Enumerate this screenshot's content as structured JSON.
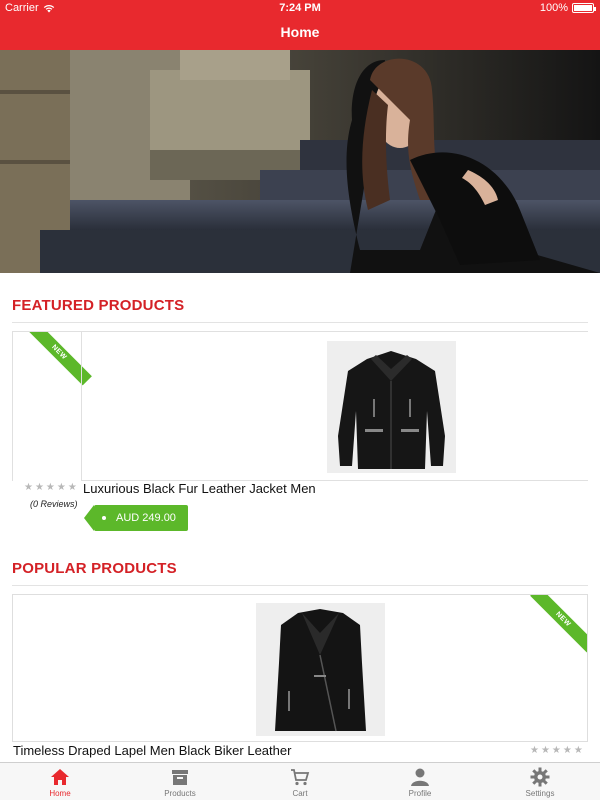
{
  "status_bar": {
    "carrier": "Carrier",
    "time": "7:24 PM",
    "battery": "100%"
  },
  "header": {
    "title": "Home"
  },
  "featured": {
    "title": "FEATURED PRODUCTS",
    "product": {
      "badge": "NEW",
      "name": "Luxurious Black Fur Leather Jacket Men",
      "rating_stars": "★★★★★",
      "reviews": "(0 Reviews)",
      "price": "AUD 249.00"
    }
  },
  "popular": {
    "title": "POPULAR PRODUCTS",
    "product": {
      "badge": "NEW",
      "name": "Timeless Draped Lapel Men Black Biker Leather",
      "rating_stars": "★★★★★"
    }
  },
  "tabs": [
    {
      "label": "Home",
      "icon": "home-icon",
      "active": true
    },
    {
      "label": "Products",
      "icon": "archive-box-icon",
      "active": false
    },
    {
      "label": "Cart",
      "icon": "cart-icon",
      "active": false
    },
    {
      "label": "Profile",
      "icon": "person-icon",
      "active": false
    },
    {
      "label": "Settings",
      "icon": "gear-icon",
      "active": false
    }
  ],
  "colors": {
    "brand_red": "#e8292e",
    "section_red": "#d42126",
    "accent_green": "#5cb82a"
  }
}
